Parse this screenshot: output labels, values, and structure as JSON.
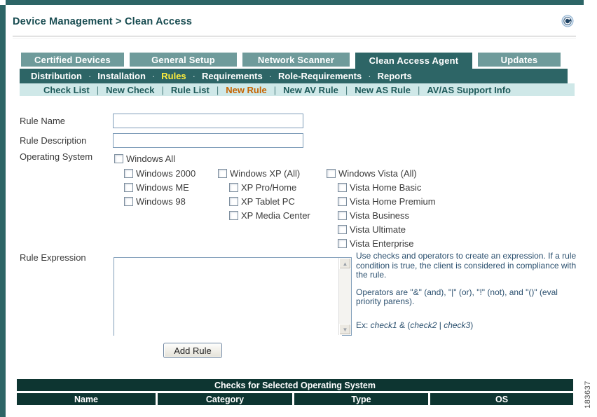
{
  "page": {
    "title": "Device Management > Clean Access",
    "figure_number": "183637"
  },
  "icons": {
    "refresh": "circular-arrow"
  },
  "tabs": [
    {
      "label": "Certified Devices",
      "active": false
    },
    {
      "label": "General Setup",
      "active": false
    },
    {
      "label": "Network Scanner",
      "active": false
    },
    {
      "label": "Clean Access Agent",
      "active": true
    },
    {
      "label": "Updates",
      "active": false
    }
  ],
  "subnav": {
    "separator": "·",
    "items": [
      {
        "label": "Distribution",
        "active": false
      },
      {
        "label": "Installation",
        "active": false
      },
      {
        "label": "Rules",
        "active": true
      },
      {
        "label": "Requirements",
        "active": false
      },
      {
        "label": "Role-Requirements",
        "active": false
      },
      {
        "label": "Reports",
        "active": false
      }
    ]
  },
  "rulenav": {
    "separator": "|",
    "items": [
      {
        "label": "Check List",
        "active": false
      },
      {
        "label": "New Check",
        "active": false
      },
      {
        "label": "Rule List",
        "active": false
      },
      {
        "label": "New Rule",
        "active": true
      },
      {
        "label": "New AV Rule",
        "active": false
      },
      {
        "label": "New AS Rule",
        "active": false
      },
      {
        "label": "AV/AS Support Info",
        "active": false
      }
    ]
  },
  "form": {
    "rule_name_label": "Rule Name",
    "rule_name_value": "",
    "rule_description_label": "Rule Description",
    "rule_description_value": "",
    "operating_system_label": "Operating System",
    "rule_expression_label": "Rule Expression",
    "rule_expression_value": "",
    "add_rule_button": "Add Rule",
    "os_options": {
      "all": {
        "label": "Windows All",
        "checked": false
      },
      "col1": [
        {
          "label": "Windows 2000",
          "checked": false
        },
        {
          "label": "Windows ME",
          "checked": false
        },
        {
          "label": "Windows 98",
          "checked": false
        }
      ],
      "col2_parent": {
        "label": "Windows XP (All)",
        "checked": false
      },
      "col2": [
        {
          "label": "XP Pro/Home",
          "checked": false
        },
        {
          "label": "XP Tablet PC",
          "checked": false
        },
        {
          "label": "XP Media Center",
          "checked": false
        }
      ],
      "col3_parent": {
        "label": "Windows Vista (All)",
        "checked": false
      },
      "col3": [
        {
          "label": "Vista Home Basic",
          "checked": false
        },
        {
          "label": "Vista Home Premium",
          "checked": false
        },
        {
          "label": "Vista Business",
          "checked": false
        },
        {
          "label": "Vista Ultimate",
          "checked": false
        },
        {
          "label": "Vista Enterprise",
          "checked": false
        }
      ]
    }
  },
  "help": {
    "para1": "Use checks and operators to create an expression. If a rule condition is true, the client is considered in compliance with the rule.",
    "para2": "Operators are \"&\" (and), \"|\" (or), \"!\" (not), and \"()\" (eval priority parens).",
    "example": {
      "prefix": "Ex: ",
      "check1": "check1",
      "op1": " & (",
      "check2": "check2",
      "op2": " | ",
      "check3": "check3",
      "suffix": ")"
    }
  },
  "checks_table": {
    "title": "Checks for Selected Operating System",
    "columns": [
      "Name",
      "Category",
      "Type",
      "OS"
    ],
    "rows": []
  },
  "colors": {
    "dark_teal": "#2d6566",
    "tab_inactive": "#6f9b9b",
    "pale_teal": "#cfe8e8",
    "table_header_bg": "#0d3531",
    "highlight_yellow": "#ffee3c",
    "highlight_orange": "#c66400",
    "help_text": "#2a4f6e"
  }
}
